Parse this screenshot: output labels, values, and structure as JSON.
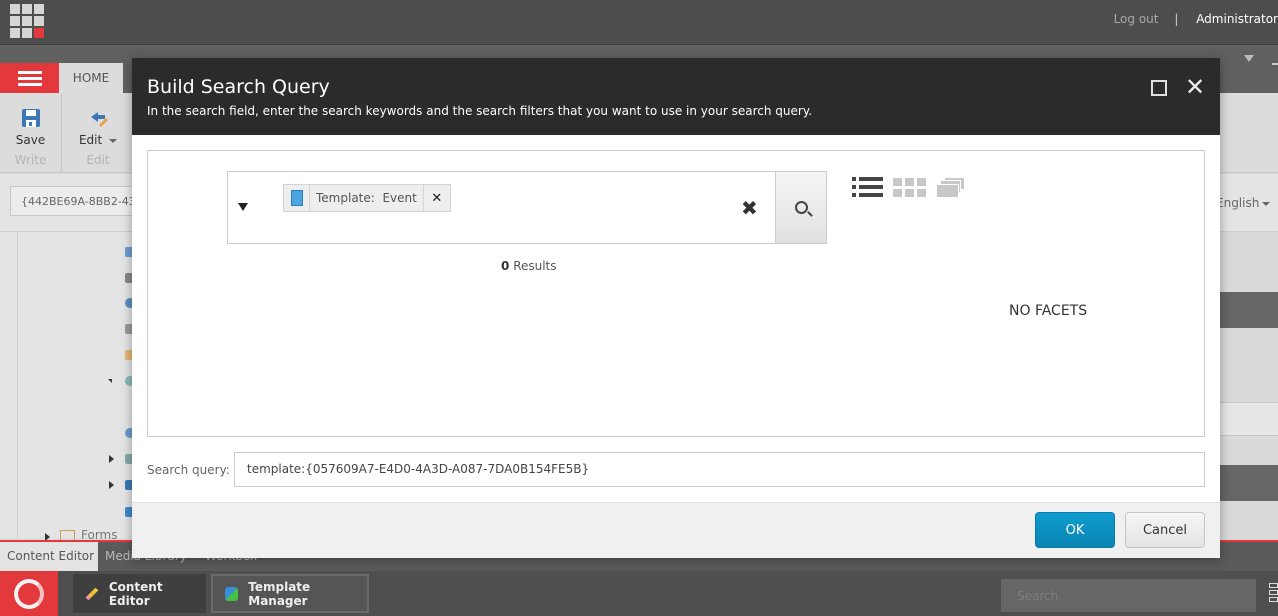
{
  "header": {
    "logout_label": "Log out",
    "separator": "|",
    "user_label": "Administrator"
  },
  "ribbon": {
    "home_tab": "HOME",
    "save_label": "Save",
    "save_group": "Write",
    "edit_label": "Edit",
    "edit_group": "Edit"
  },
  "item_id": "{442BE69A-8BB2-43",
  "language": "English",
  "tree": {
    "forms_label": "Forms"
  },
  "bottom_tabs": [
    {
      "label": "Content Editor",
      "active": true
    },
    {
      "label": "Media Library",
      "active": false
    },
    {
      "label": "Workbox",
      "active": false
    }
  ],
  "taskbar": {
    "apps": [
      {
        "label": "Content Editor",
        "icon": "pencil-icon"
      },
      {
        "label": "Template Manager",
        "icon": "puzzle-icon"
      }
    ],
    "search_placeholder": "Search"
  },
  "dialog": {
    "title": "Build Search Query",
    "subtitle": "In the search field, enter the search keywords and the search filters that you want to use in your search query.",
    "chip": {
      "label": "Template:",
      "value": "Event"
    },
    "results_count": "0",
    "results_label": "Results",
    "no_facets": "NO FACETS",
    "query_label": "Search query:",
    "query_value": "template:{057609A7-E4D0-4A3D-A087-7DA0B154FE5B}",
    "ok_label": "OK",
    "cancel_label": "Cancel"
  },
  "colors": {
    "brand_red": "#e4393c",
    "primary_button": "#0a8fc0",
    "dialog_header": "#2b2b2b"
  }
}
